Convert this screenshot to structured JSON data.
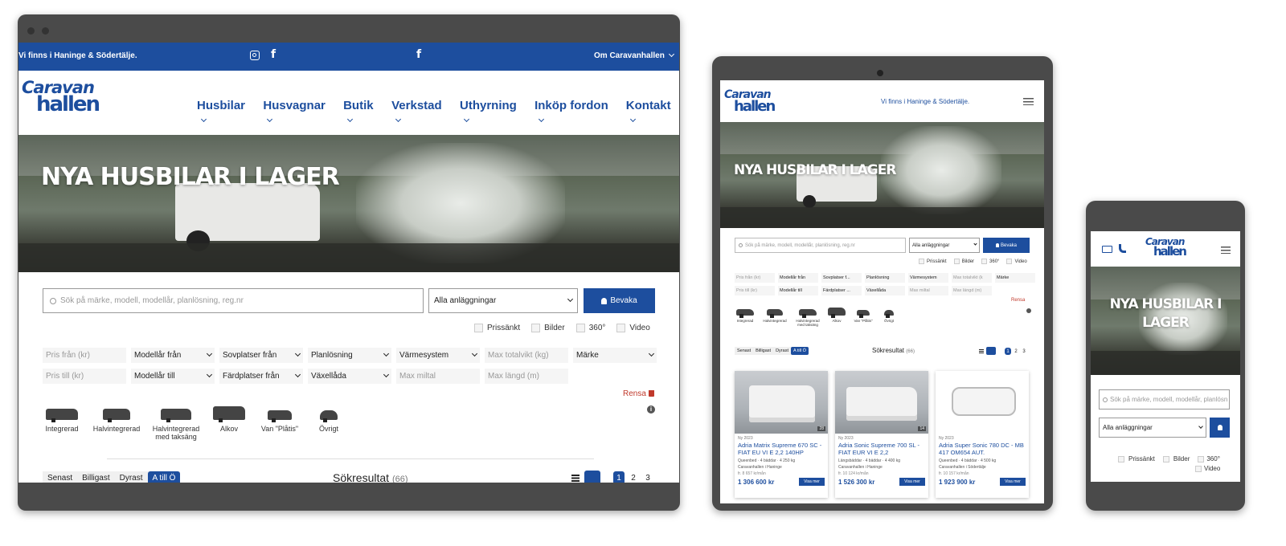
{
  "site": {
    "logo_line1": "Caravan",
    "logo_line2": "hallen",
    "brand_color": "#1d4e9e",
    "tagline": "Vi finns i Haninge & Södertälje.",
    "om_link": "Om Caravanhallen",
    "hero_title": "NYA HUSBILAR I LAGER",
    "hero_title_mobile_1": "NYA HUSBILAR I",
    "hero_title_mobile_2": "LAGER"
  },
  "nav": [
    {
      "label": "Husbilar"
    },
    {
      "label": "Husvagnar"
    },
    {
      "label": "Butik"
    },
    {
      "label": "Verkstad"
    },
    {
      "label": "Uthyrning"
    },
    {
      "label": "Inköp fordon"
    },
    {
      "label": "Kontakt"
    }
  ],
  "search": {
    "placeholder": "Sök på märke, modell, modellår, planlösning, reg.nr",
    "placeholder_mobile": "Sök på märke, modell, modellår, planlösn",
    "facility": "Alla anläggningar",
    "watch_button": "Bevaka"
  },
  "checkboxes": [
    "Prissänkt",
    "Bilder",
    "360°",
    "Video"
  ],
  "filters": {
    "row1": [
      {
        "label": "Pris från (kr)",
        "kind": "input"
      },
      {
        "label": "Modellår från",
        "kind": "select"
      },
      {
        "label": "Sovplatser från",
        "kind": "select"
      },
      {
        "label": "Planlösning",
        "kind": "select"
      },
      {
        "label": "Värmesystem",
        "kind": "select"
      },
      {
        "label": "Max totalvikt (kg)",
        "kind": "input"
      },
      {
        "label": "Märke",
        "kind": "select"
      }
    ],
    "row2": [
      {
        "label": "Pris till (kr)",
        "kind": "input"
      },
      {
        "label": "Modellår till",
        "kind": "select"
      },
      {
        "label": "Färdplatser från",
        "kind": "select"
      },
      {
        "label": "Växellåda",
        "kind": "select"
      },
      {
        "label": "Max miltal",
        "kind": "input"
      },
      {
        "label": "Max längd (m)",
        "kind": "input"
      }
    ],
    "tablet_row1": [
      "Pris från (kr)",
      "Modellår från",
      "Sovplatser f...",
      "Planlösning",
      "Värmesystem",
      "Max totalvikt (k",
      "Märke"
    ],
    "tablet_row2": [
      "Pris till (kr)",
      "Modellår till",
      "Färdplatser ...",
      "Växellåda",
      "Max miltal",
      "Max längd (m)"
    ],
    "clear": "Rensa"
  },
  "vehicle_types": [
    {
      "line1": "Integrerad",
      "line2": ""
    },
    {
      "line1": "Halvintegrerad",
      "line2": ""
    },
    {
      "line1": "Halvintegrerad",
      "line2": "med taksäng"
    },
    {
      "line1": "Alkov",
      "line2": ""
    },
    {
      "line1": "Van \"Plåtis\"",
      "line2": ""
    },
    {
      "line1": "Övrigt",
      "line2": ""
    }
  ],
  "sort": [
    "Senast",
    "Billigast",
    "Dyrast",
    "A till Ö"
  ],
  "sort_active": "A till Ö",
  "results": {
    "label": "Sökresultat",
    "count": "(66)"
  },
  "pages": [
    "1",
    "2",
    "3"
  ],
  "cards": [
    {
      "year": "Ny 2023",
      "title": "Adria Matrix Supreme 670 SC - FIAT EU VI E 2,2 140HP",
      "specs": "Queenbed · 4 bäddar · 4 250 kg",
      "location": "Caravanhallen i Haninge",
      "monthly": "fr. 8 657 kr/mån",
      "price": "1 306 600 kr",
      "photos": "28",
      "cta": "Visa mer"
    },
    {
      "year": "Ny 2023",
      "title": "Adria Sonic Supreme 700 SL - FIAT EUR VI E 2,2",
      "specs": "Längsbäddar · 4 bäddar · 4 400 kg",
      "location": "Caravanhallen i Haninge",
      "monthly": "fr. 10 124 kr/mån",
      "price": "1 526 300 kr",
      "photos": "14",
      "cta": "Visa mer"
    },
    {
      "year": "Ny 2023",
      "title": "Adria Super Sonic 780 DC - MB 417 OM654 AUT.",
      "specs": "Queenbed · 4 bäddar · 4 500 kg",
      "location": "Caravanhallen i Södertälje",
      "monthly": "fr. 10 157 kr/mån",
      "price": "1 923 900 kr",
      "photos": "",
      "cta": "Visa mer"
    }
  ],
  "icons": [
    "instagram-icon",
    "facebook-icon",
    "bell-icon",
    "search-icon",
    "trash-icon",
    "info-icon",
    "list-view-icon",
    "grid-view-icon",
    "hamburger-icon",
    "mail-icon",
    "phone-icon",
    "chevron-down-icon"
  ]
}
